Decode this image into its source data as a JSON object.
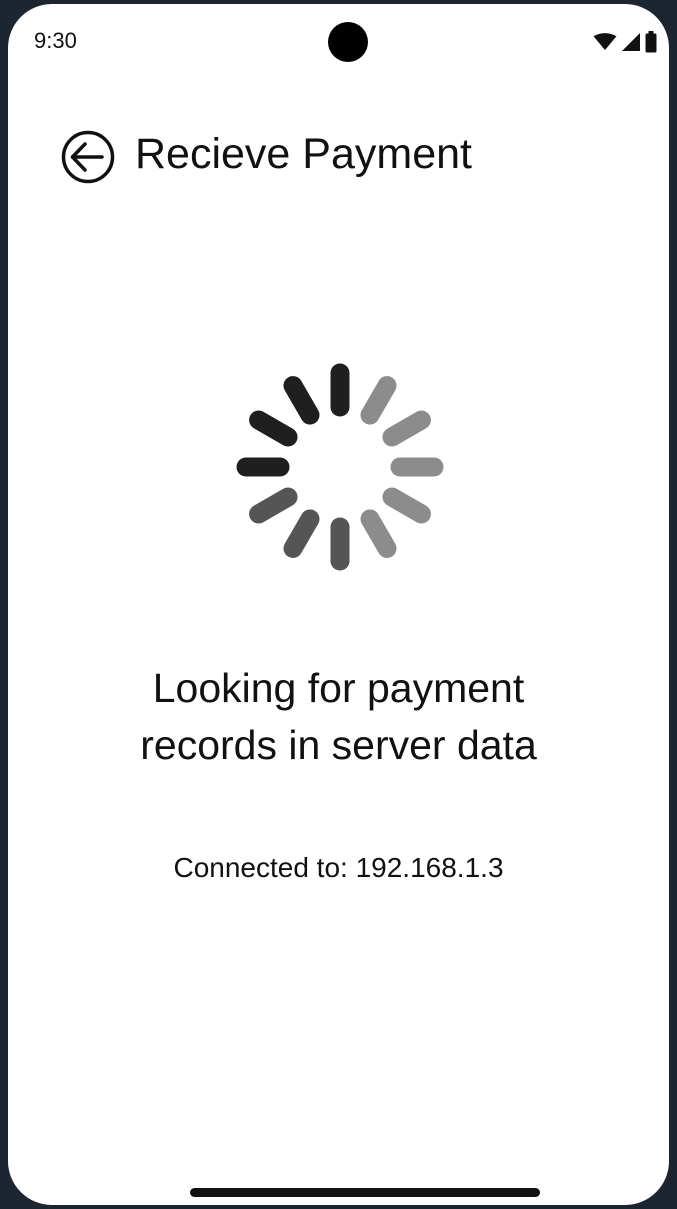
{
  "status_bar": {
    "time": "9:30",
    "icons": [
      "wifi-icon",
      "cellular-signal-icon",
      "battery-icon"
    ]
  },
  "app_bar": {
    "back_icon": "arrow-left-circle-icon",
    "title": "Recieve Payment"
  },
  "loader": {
    "icon": "loading-spinner-icon",
    "colors": {
      "dark": "#1f1f1f",
      "medium": "#555555",
      "light": "#8c8c8c"
    }
  },
  "message": {
    "line1": "Looking for payment",
    "line2": "records in server data"
  },
  "connection": {
    "label": "Connected to:",
    "address": "192.168.1.3"
  },
  "theme": {
    "frame": "#1d2530",
    "screen": "#ffffff",
    "text": "#111111"
  }
}
